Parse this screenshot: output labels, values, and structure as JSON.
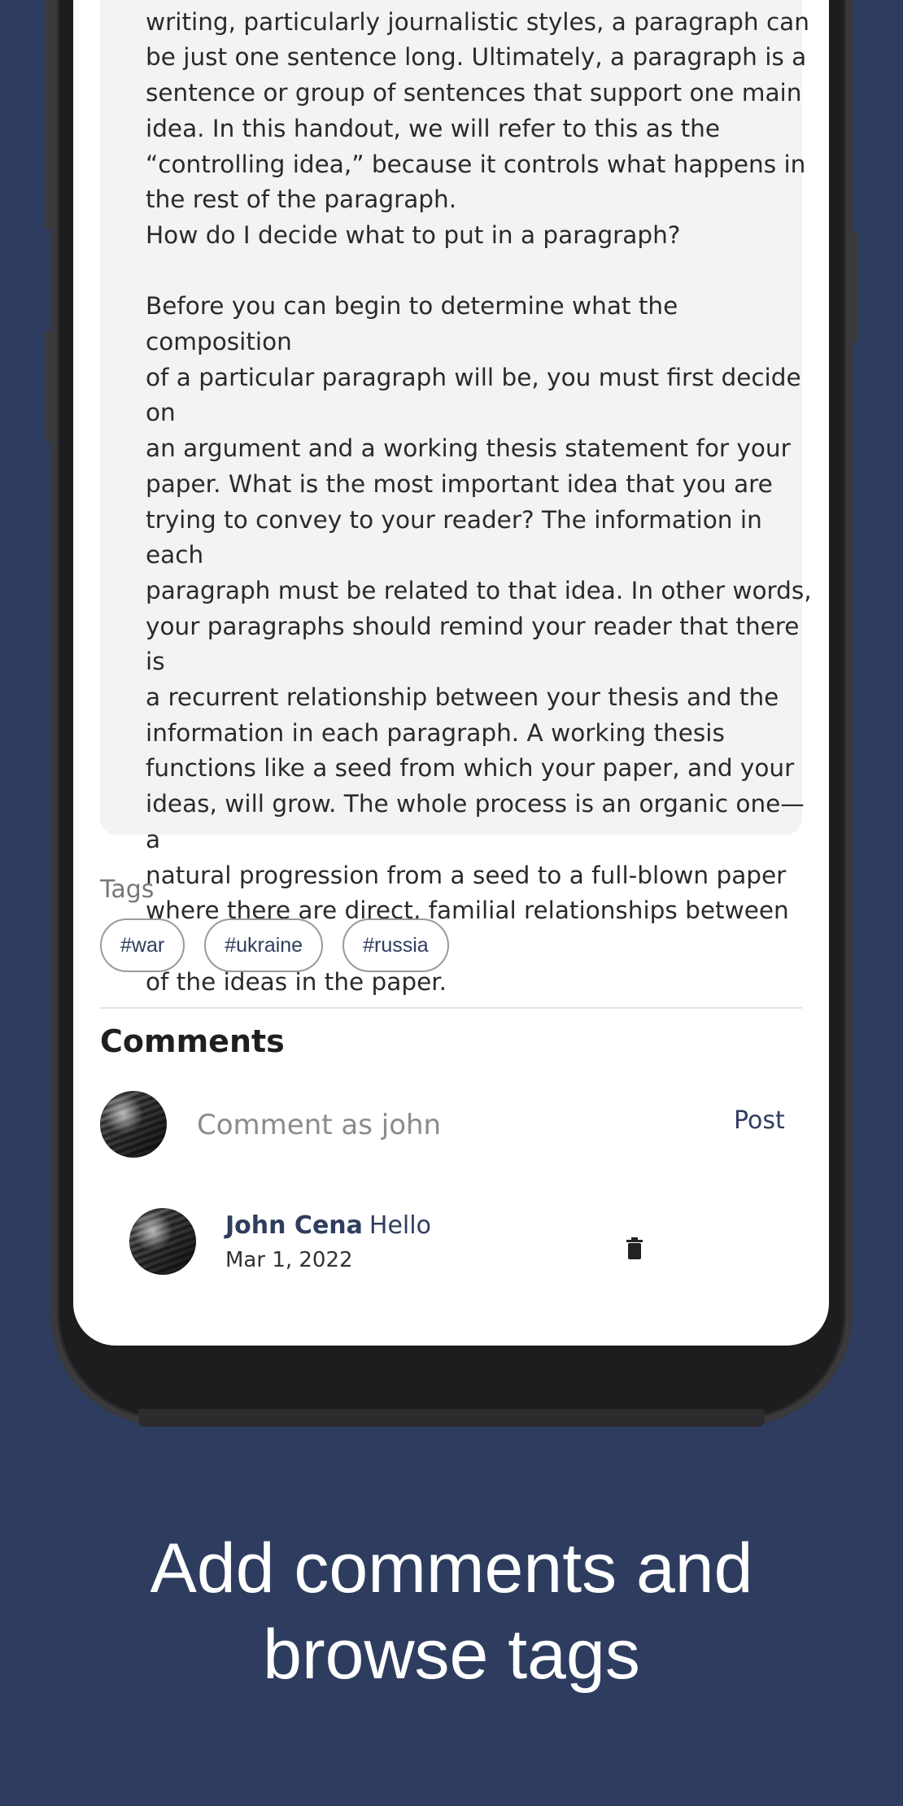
{
  "article": {
    "text": "paper is a paragraph. For instance, in some styles of\nwriting, particularly journalistic styles, a paragraph can\nbe just one sentence long. Ultimately, a paragraph is a\nsentence or group of sentences that support one main\nidea. In this handout, we will refer to this as the\n“controlling idea,” because it controls what happens in\nthe rest of the paragraph.\nHow do I decide what to put in a paragraph?\n\nBefore you can begin to determine what the composition\nof a particular paragraph will be, you must first decide on\nan argument and a working thesis statement for your\npaper. What is the most important idea that you are\ntrying to convey to your reader? The information in each\nparagraph must be related to that idea. In other words,\nyour paragraphs should remind your reader that there is\na recurrent relationship between your thesis and the\ninformation in each paragraph. A working thesis\nfunctions like a seed from which your paper, and your\nideas, will grow. The whole process is an organic one—a\nnatural progression from a seed to a full-blown paper\nwhere there are direct, familial relationships between all\nof the ideas in the paper."
  },
  "tags": {
    "title": "Tags",
    "items": [
      "#war",
      "#ukraine",
      "#russia"
    ]
  },
  "comments": {
    "title": "Comments",
    "composer": {
      "avatar_icon": "user-avatar",
      "placeholder": "Comment as john",
      "value": "",
      "post_label": "Post"
    },
    "items": [
      {
        "avatar_icon": "user-avatar",
        "author": "John Cena",
        "text": "Hello",
        "date": "Mar 1, 2022",
        "delete_icon": "trash-icon"
      }
    ]
  },
  "caption": {
    "line1": "Add comments and",
    "line2": "browse tags"
  },
  "colors": {
    "background": "#2e3d5f",
    "accent": "#2f3d5e"
  }
}
